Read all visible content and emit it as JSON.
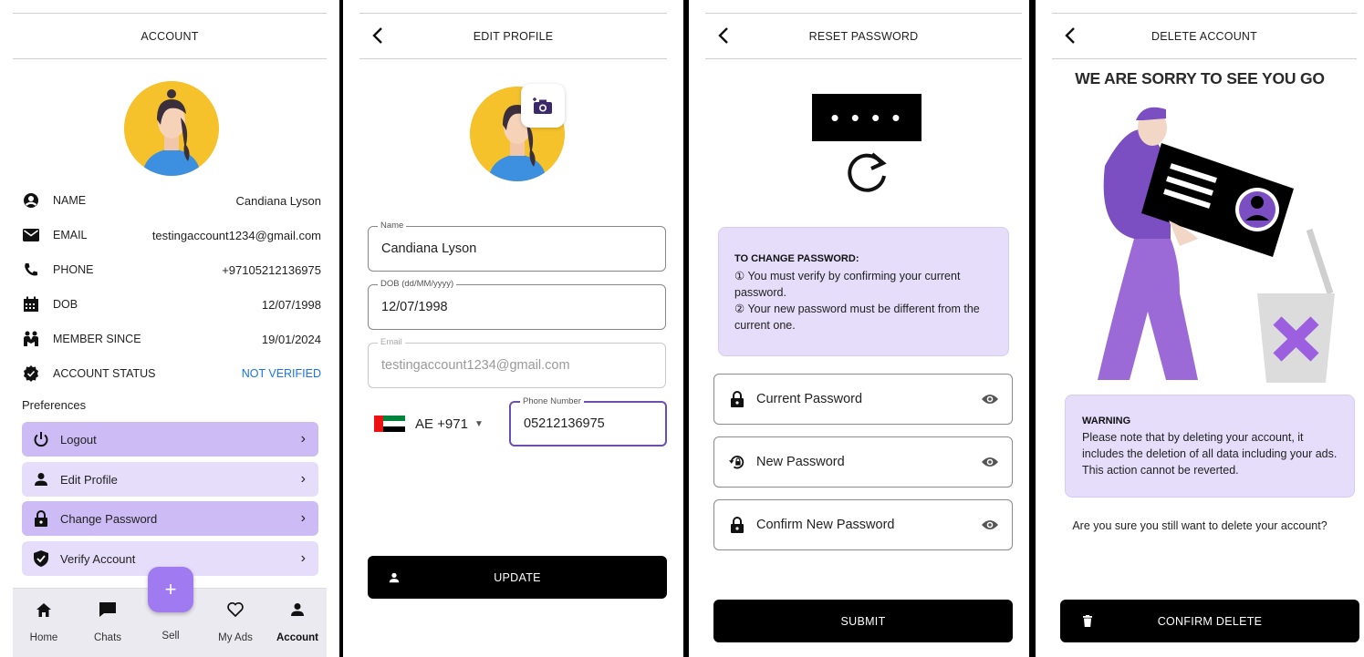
{
  "account": {
    "title": "ACCOUNT",
    "rows": [
      {
        "label": "NAME",
        "value": "Candiana Lyson",
        "icon": "person-circle-icon"
      },
      {
        "label": "EMAIL",
        "value": "testingaccount1234@gmail.com",
        "icon": "mail-icon"
      },
      {
        "label": "PHONE",
        "value": "+97105212136975",
        "icon": "phone-icon"
      },
      {
        "label": "DOB",
        "value": "12/07/1998",
        "icon": "calendar-icon"
      },
      {
        "label": "MEMBER SINCE",
        "value": "19/01/2024",
        "icon": "handshake-icon"
      },
      {
        "label": "ACCOUNT STATUS",
        "value": "NOT VERIFIED",
        "icon": "shield-badge-icon"
      }
    ],
    "preferences_title": "Preferences",
    "menu": [
      {
        "label": "Logout",
        "icon": "power-icon"
      },
      {
        "label": "Edit Profile",
        "icon": "person-icon"
      },
      {
        "label": "Change Password",
        "icon": "lock-icon"
      },
      {
        "label": "Verify Account",
        "icon": "shield-check-icon"
      }
    ],
    "nav": [
      {
        "label": "Home",
        "icon": "home-icon"
      },
      {
        "label": "Chats",
        "icon": "chat-icon"
      },
      {
        "label": "Sell",
        "icon": "plus-icon"
      },
      {
        "label": "My Ads",
        "icon": "heart-icon"
      },
      {
        "label": "Account",
        "icon": "person-icon"
      }
    ],
    "fab_symbol": "+"
  },
  "edit_profile": {
    "title": "EDIT PROFILE",
    "name_label": "Name",
    "name_value": "Candiana Lyson",
    "dob_label": "DOB (dd/MM/yyyy)",
    "dob_value": "12/07/1998",
    "email_label": "Email",
    "email_value": "testingaccount1234@gmail.com",
    "country_code": "AE +971",
    "phone_label": "Phone Number",
    "phone_value": "05212136975",
    "update_label": "UPDATE"
  },
  "reset_password": {
    "title": "RESET PASSWORD",
    "dots": "• • • •",
    "info_title": "TO CHANGE PASSWORD:",
    "info_line1": "① You must verify by confirming your current password.",
    "info_line2": "② Your new password must be different from the current one.",
    "current_label": "Current Password",
    "new_label": "New Password",
    "confirm_label": "Confirm New Password",
    "submit_label": "SUBMIT"
  },
  "delete_account": {
    "title": "DELETE ACCOUNT",
    "headline": "WE ARE SORRY TO SEE YOU GO",
    "warning_title": "WARNING",
    "warning_text": "Please note that by deleting your account, it includes the deletion of all data including your ads. This action cannot be reverted.",
    "question": "Are you sure you still want to delete your account?",
    "confirm_label": "CONFIRM DELETE"
  },
  "colors": {
    "accent_purple": "#a07af0",
    "menu_dark": "#cdbbf6",
    "menu_light": "#e6ddfb",
    "blue_status": "#1a73e8",
    "black": "#000000"
  }
}
